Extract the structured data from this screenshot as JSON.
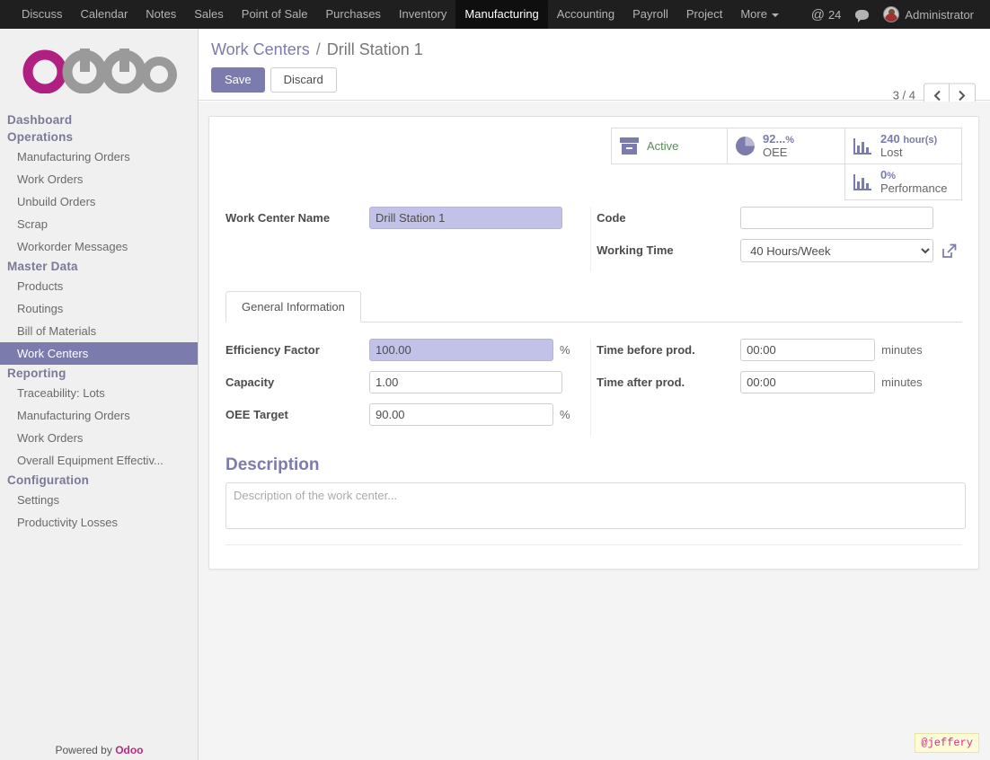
{
  "topbar": {
    "menu_items": [
      {
        "label": "Discuss",
        "active": false
      },
      {
        "label": "Calendar",
        "active": false
      },
      {
        "label": "Notes",
        "active": false
      },
      {
        "label": "Sales",
        "active": false
      },
      {
        "label": "Point of Sale",
        "active": false
      },
      {
        "label": "Purchases",
        "active": false
      },
      {
        "label": "Inventory",
        "active": false
      },
      {
        "label": "Manufacturing",
        "active": true
      },
      {
        "label": "Accounting",
        "active": false
      },
      {
        "label": "Payroll",
        "active": false
      },
      {
        "label": "Project",
        "active": false
      },
      {
        "label": "More",
        "active": false
      }
    ],
    "mention_count": "24",
    "user_name": "Administrator"
  },
  "sidebar": {
    "logo_text": "odoo",
    "sections": [
      {
        "type": "section",
        "label": "Dashboard"
      },
      {
        "type": "section",
        "label": "Operations"
      },
      {
        "type": "item",
        "label": "Manufacturing Orders",
        "selected": false
      },
      {
        "type": "item",
        "label": "Work Orders",
        "selected": false
      },
      {
        "type": "item",
        "label": "Unbuild Orders",
        "selected": false
      },
      {
        "type": "item",
        "label": "Scrap",
        "selected": false
      },
      {
        "type": "item",
        "label": "Workorder Messages",
        "selected": false
      },
      {
        "type": "section",
        "label": "Master Data"
      },
      {
        "type": "item",
        "label": "Products",
        "selected": false
      },
      {
        "type": "item",
        "label": "Routings",
        "selected": false
      },
      {
        "type": "item",
        "label": "Bill of Materials",
        "selected": false
      },
      {
        "type": "item",
        "label": "Work Centers",
        "selected": true
      },
      {
        "type": "section",
        "label": "Reporting"
      },
      {
        "type": "item",
        "label": "Traceability: Lots",
        "selected": false
      },
      {
        "type": "item",
        "label": "Manufacturing Orders",
        "selected": false
      },
      {
        "type": "item",
        "label": "Work Orders",
        "selected": false
      },
      {
        "type": "item",
        "label": "Overall Equipment Effectiv...",
        "selected": false
      },
      {
        "type": "section",
        "label": "Configuration"
      },
      {
        "type": "item",
        "label": "Settings",
        "selected": false
      },
      {
        "type": "item",
        "label": "Productivity Losses",
        "selected": false
      }
    ],
    "footer_prefix": "Powered by",
    "footer_brand": "Odoo"
  },
  "control_panel": {
    "breadcrumb_root": "Work Centers",
    "breadcrumb_sep": "/",
    "breadcrumb_current": "Drill Station 1",
    "save_label": "Save",
    "discard_label": "Discard",
    "pager_text": "3 / 4",
    "pager_prev": "‹",
    "pager_next": "›"
  },
  "stats": [
    {
      "name": "active",
      "value": "",
      "unit": "",
      "label": "Active",
      "icon": "archive-icon"
    },
    {
      "name": "oee",
      "value": "92...",
      "unit": "%",
      "label": "OEE",
      "icon": "pie-chart-icon"
    },
    {
      "name": "lost",
      "value": "240",
      "unit": "hour(s)",
      "label": "Lost",
      "icon": "bar-chart-icon"
    },
    {
      "name": "performance",
      "value": "0",
      "unit": "%",
      "label": "Performance",
      "icon": "bar-chart-icon"
    }
  ],
  "form": {
    "work_center_name_label": "Work Center Name",
    "work_center_name_value": "Drill Station 1",
    "code_label": "Code",
    "code_value": "",
    "working_time_label": "Working Time",
    "working_time_value": "40 Hours/Week",
    "working_time_options": [
      "40 Hours/Week"
    ],
    "tab_general_label": "General Information",
    "efficiency_factor_label": "Efficiency Factor",
    "efficiency_factor_value": "100.00",
    "efficiency_factor_suffix": "%",
    "capacity_label": "Capacity",
    "capacity_value": "1.00",
    "oee_target_label": "OEE Target",
    "oee_target_value": "90.00",
    "oee_target_suffix": "%",
    "time_before_label": "Time before prod.",
    "time_before_value": "00:00",
    "time_before_suffix": "minutes",
    "time_after_label": "Time after prod.",
    "time_after_value": "00:00",
    "time_after_suffix": "minutes",
    "description_title": "Description",
    "description_value": "",
    "description_placeholder": "Description of the work center..."
  },
  "watermark": "@jeffery",
  "colors": {
    "accent": "#7c7bad",
    "brand_magenta": "#c0277f",
    "topbar_bg": "#1f1f1f",
    "selected_field": "#c2c1e8",
    "active_green": "#5a8a5a"
  }
}
